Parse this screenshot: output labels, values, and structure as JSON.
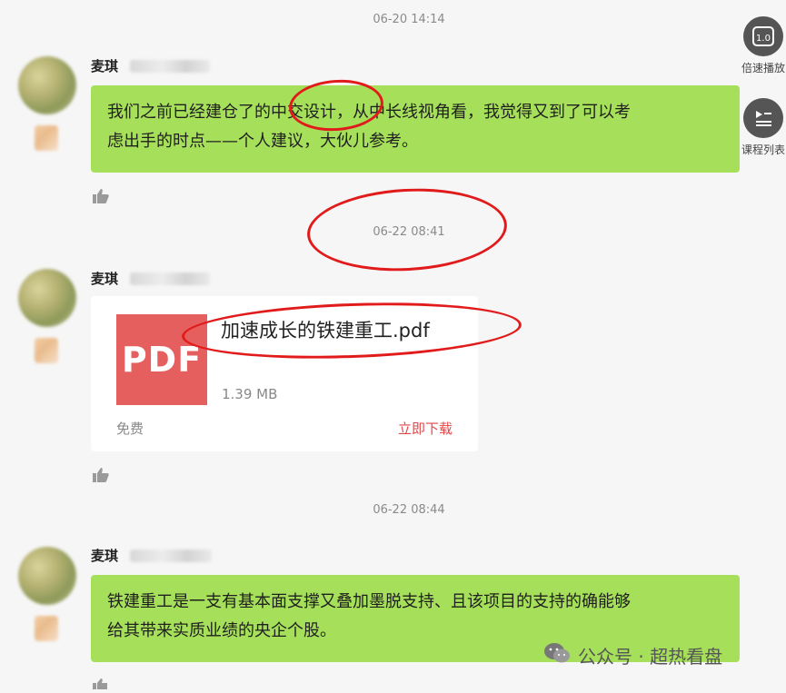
{
  "messages": [
    {
      "timestamp": "06-20 14:14",
      "sender": "麦琪",
      "text_line1": "我们之前已经建仓了的中交设计，从中长线视角看，我觉得又到了可以考",
      "text_line2": "虑出手的时点——个人建议，大伙儿参考。"
    },
    {
      "timestamp": "06-22 08:41",
      "sender": "麦琪",
      "file": {
        "thumb_label": "PDF",
        "name": "加速成长的铁建重工.pdf",
        "size": "1.39 MB",
        "price": "免费",
        "download": "立即下载"
      }
    },
    {
      "timestamp": "06-22 08:44",
      "sender": "麦琪",
      "text_line1": "铁建重工是一支有基本面支撑又叠加墨脱支持、且该项目的支持的确能够",
      "text_line2": "给其带来实质业绩的央企个股。"
    }
  ],
  "sidebar": {
    "speed_label": "倍速播放",
    "speed_icon_text": "1.0",
    "list_label": "课程列表"
  },
  "watermark": "公众号 · 超热看盘",
  "colors": {
    "bubble": "#a6e05a",
    "pdf_thumb": "#e65f5f",
    "download": "#e0474a",
    "annotation": "#e11b1b"
  }
}
